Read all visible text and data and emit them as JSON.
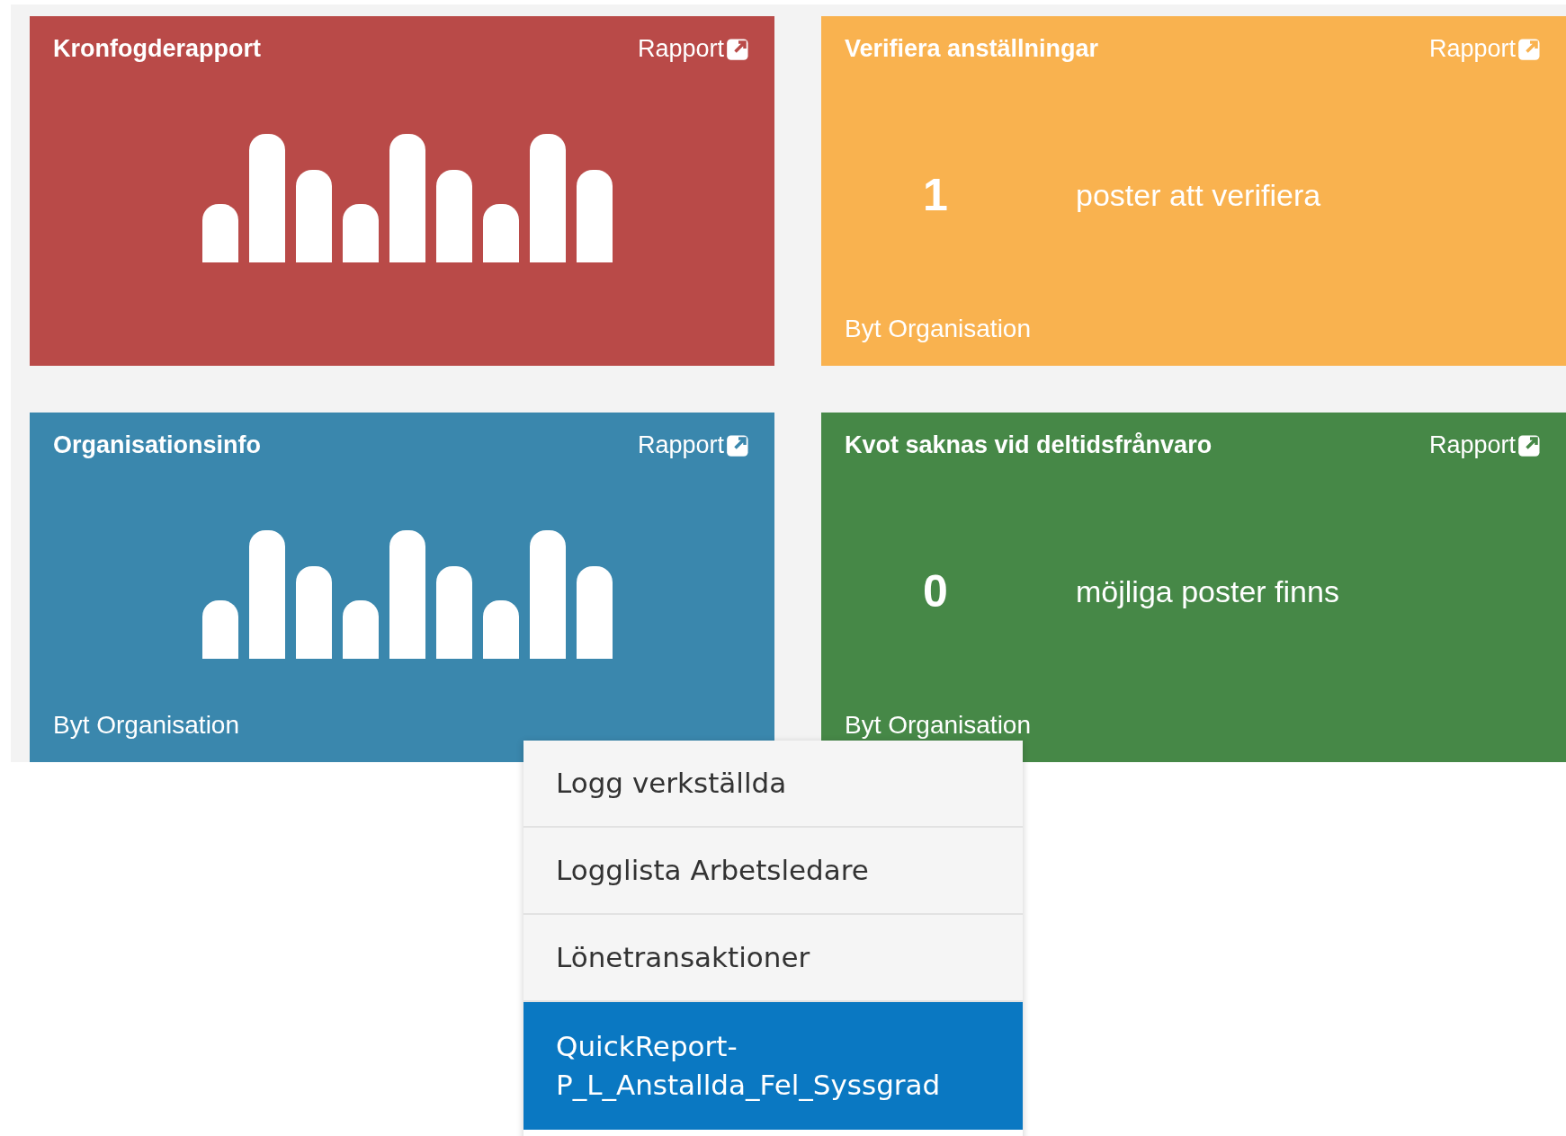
{
  "cards": [
    {
      "kind": "chart",
      "title": "Kronfogderapport",
      "link": "Rapport",
      "color": "#b94a48"
    },
    {
      "kind": "count",
      "title": "Verifiera anställningar",
      "link": "Rapport",
      "color": "#f9b24f",
      "count": "1",
      "caption": "poster att verifiera",
      "footer": "Byt Organisation"
    },
    {
      "kind": "chart",
      "title": "Organisationsinfo",
      "link": "Rapport",
      "color": "#3a87ad",
      "footer": "Byt Organisation"
    },
    {
      "kind": "count",
      "title": "Kvot saknas vid deltidsfrånvaro",
      "link": "Rapport",
      "color": "#468847",
      "count": "0",
      "caption": "möjliga poster finns",
      "footer": "Byt Organisation"
    }
  ],
  "menu": {
    "items": [
      {
        "label": "Logg verkställda",
        "selected": false
      },
      {
        "label": "Logglista Arbetsledare",
        "selected": false
      },
      {
        "label": "Lönetransaktioner",
        "selected": false
      },
      {
        "label": "QuickReport-\nP_L_Anstallda_Fel_Syssgrad",
        "selected": true
      }
    ]
  }
}
